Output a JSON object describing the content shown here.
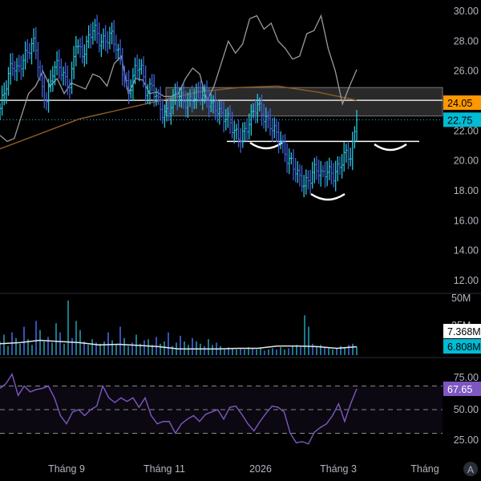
{
  "colors": {
    "background": "#000000",
    "up_bar": "#26c6da",
    "down_bar": "#3f5fd9",
    "comparison_line": "#9a9a9a",
    "ma_line": "#8a5a22",
    "rsi_line": "#7e57c2",
    "last_price_badge": "#00bcd4",
    "level_badge": "#ff9800",
    "rsi_badge": "#7e57c2"
  },
  "price_axis": {
    "ticks": [
      "30.00",
      "28.00",
      "26.00",
      "24.00",
      "22.00",
      "20.00",
      "18.00",
      "16.00",
      "14.00",
      "12.00"
    ],
    "tick_values": [
      30,
      28,
      26,
      24,
      22,
      20,
      18,
      16,
      14,
      12
    ]
  },
  "badges": {
    "level": "24.05",
    "last_price": "22.75",
    "volume_ma": "7.368M",
    "volume": "6.808M",
    "rsi": "67.65"
  },
  "volume_axis": {
    "ticks": [
      "50M",
      "25M"
    ]
  },
  "rsi_axis": {
    "ticks": [
      "75.00",
      "50.00",
      "25.00"
    ]
  },
  "time_axis": {
    "labels": [
      "Tháng 9",
      "Tháng 11",
      "2026",
      "Tháng 3",
      "Tháng"
    ]
  },
  "auto_scale_button": "A",
  "chart_data": {
    "type": "line",
    "title": "",
    "price_ylim": [
      12,
      30
    ],
    "price": [
      23.5,
      25,
      26.5,
      26,
      26.8,
      27.5,
      28,
      25,
      24,
      26,
      26.5,
      25.5,
      25,
      28,
      27,
      28,
      29,
      28,
      28,
      28.5,
      27.5,
      26,
      24.5,
      26,
      26.5,
      24.5,
      25,
      24,
      23,
      23.5,
      24.5,
      24.2,
      23.8,
      24.3,
      24.5,
      24.4,
      23.8,
      23.5,
      23,
      22.8,
      22,
      21.5,
      22,
      23,
      23.8,
      23,
      22.5,
      22,
      21.3,
      20.2,
      19.8,
      19,
      18.4,
      18.8,
      19.6,
      19,
      19.4,
      19,
      19.6,
      20.5,
      20.3,
      22.75
    ],
    "comparison": [
      21.7,
      21.3,
      21.5,
      23,
      24.5,
      25,
      26,
      25,
      25.5,
      24.5,
      25.2,
      25,
      24.8,
      25.8,
      25.6,
      25,
      26.5,
      27,
      24.5,
      25.5,
      25.4,
      24.5,
      24.6,
      24.3,
      24.3,
      24.5,
      25.5,
      26.2,
      25.8,
      24,
      25,
      26.5,
      28,
      27.2,
      27.8,
      29.5,
      29.7,
      28.8,
      29.2,
      28,
      27.5,
      26.8,
      27,
      28.5,
      28.7,
      29.7,
      27.5,
      26,
      23.8,
      25,
      26.1
    ],
    "moving_average": [
      20.8,
      21.8,
      22.8,
      23.4,
      24,
      24.6,
      24.9,
      25,
      24.6,
      24.05
    ],
    "levels": {
      "resistance": 24.05,
      "last": 22.75,
      "zone": [
        23.0,
        24.9
      ],
      "neckline": 21.3
    },
    "volume_millions": [
      12,
      18,
      8,
      20,
      15,
      10,
      25,
      14,
      9,
      30,
      22,
      12,
      16,
      11,
      28,
      20,
      10,
      48,
      15,
      30,
      22,
      12,
      9,
      14,
      11,
      10,
      12,
      20,
      13,
      9,
      25,
      15,
      8,
      11,
      18,
      10,
      13,
      14,
      9,
      16,
      10,
      12,
      20,
      8,
      11,
      17,
      12,
      9,
      15,
      12,
      10,
      8,
      14,
      9,
      11,
      8,
      5,
      7,
      6,
      5,
      6,
      5,
      7,
      6,
      5,
      6,
      4,
      5,
      6,
      5,
      7,
      5,
      6,
      8,
      9,
      7,
      35,
      25,
      10,
      8,
      9,
      7,
      6,
      5,
      6,
      8,
      7,
      9,
      10,
      7
    ],
    "volume_ma_millions": [
      10,
      11,
      13,
      12,
      11,
      9,
      9.5,
      8.5,
      7.5,
      5.5,
      5.5,
      5.5,
      6,
      6,
      8,
      8,
      7.5,
      6,
      7.4
    ],
    "rsi": [
      68,
      72,
      80,
      62,
      70,
      65,
      67,
      68,
      70,
      60,
      45,
      38,
      48,
      50,
      45,
      50,
      53,
      70,
      60,
      56,
      60,
      57,
      60,
      52,
      60,
      45,
      38,
      40,
      40,
      30,
      38,
      42,
      45,
      40,
      46,
      48,
      50,
      42,
      52,
      53,
      46,
      38,
      32,
      40,
      47,
      53,
      52,
      48,
      30,
      22,
      23,
      21,
      31,
      35,
      38,
      45,
      55,
      40,
      55,
      67.65
    ],
    "rsi_levels": [
      70,
      50,
      30
    ],
    "rsi_ylim": [
      10,
      90
    ]
  }
}
